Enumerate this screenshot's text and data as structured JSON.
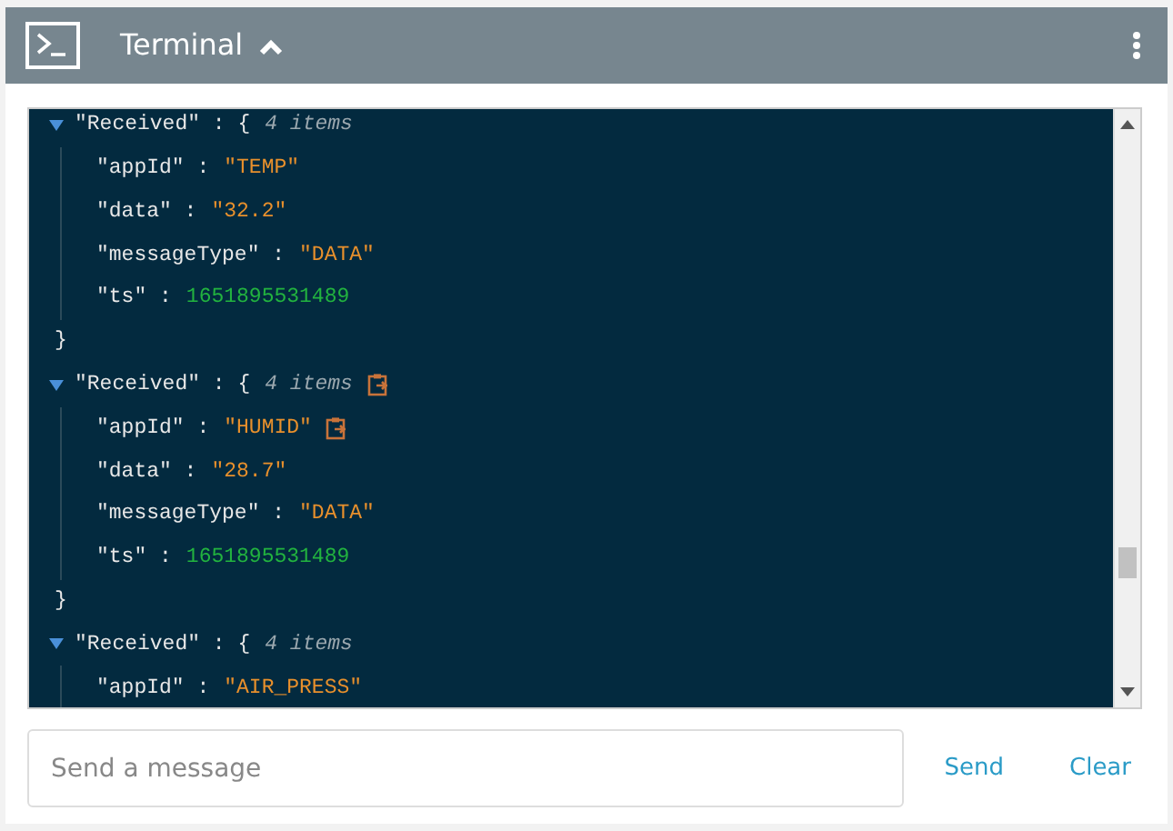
{
  "header": {
    "title": "Terminal",
    "expanded": true
  },
  "messages": [
    {
      "key": "\"Received\" : {",
      "expanded": true,
      "count": "4 items",
      "copy": false,
      "entries": [
        {
          "key": "\"appId\" :",
          "value": "\"TEMP\"",
          "kind": "string",
          "copy": false
        },
        {
          "key": "\"data\" :",
          "value": "\"32.2\"",
          "kind": "string",
          "copy": false
        },
        {
          "key": "\"messageType\" :",
          "value": "\"DATA\"",
          "kind": "string",
          "copy": false
        },
        {
          "key": "\"ts\" :",
          "value": "1651895531489",
          "kind": "number",
          "copy": false
        }
      ],
      "closing": "}"
    },
    {
      "key": "\"Received\" : {",
      "expanded": true,
      "count": "4 items",
      "copy": true,
      "entries": [
        {
          "key": "\"appId\" :",
          "value": "\"HUMID\"",
          "kind": "string",
          "copy": true
        },
        {
          "key": "\"data\" :",
          "value": "\"28.7\"",
          "kind": "string",
          "copy": false
        },
        {
          "key": "\"messageType\" :",
          "value": "\"DATA\"",
          "kind": "string",
          "copy": false
        },
        {
          "key": "\"ts\" :",
          "value": "1651895531489",
          "kind": "number",
          "copy": false
        }
      ],
      "closing": "}"
    },
    {
      "key": "\"Received\" : {",
      "expanded": true,
      "count": "4 items",
      "copy": false,
      "entries": [
        {
          "key": "\"appId\" :",
          "value": "\"AIR_PRESS\"",
          "kind": "string",
          "copy": false
        }
      ]
    }
  ],
  "input": {
    "placeholder": "Send a message"
  },
  "buttons": [
    "Send",
    "Clear"
  ]
}
